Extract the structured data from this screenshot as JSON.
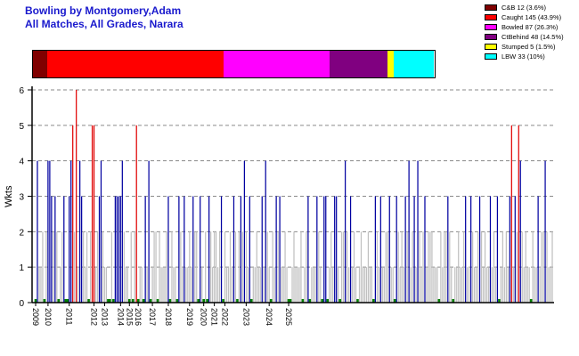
{
  "header": {
    "title_line1": "Bowling by Montgomery,Adam",
    "title_line2": "All Matches, All Grades, Narara"
  },
  "legend": [
    {
      "label": "C&B 12 (3.6%)",
      "color": "#800000"
    },
    {
      "label": "Caught 145 (43.9%)",
      "color": "#ff0000"
    },
    {
      "label": "Bowled 87 (26.3%)",
      "color": "#ff00ff"
    },
    {
      "label": "CtBehind 48 (14.5%)",
      "color": "#800080"
    },
    {
      "label": "Stumped 5 (1.5%)",
      "color": "#ffff00"
    },
    {
      "label": "LBW 33 (10%)",
      "color": "#00ffff"
    }
  ],
  "chart_data": {
    "type": "bar",
    "ylabel": "Wkts",
    "ylim": [
      0,
      6
    ],
    "yticks": [
      "0",
      "1",
      "2",
      "3",
      "4",
      "5",
      "6"
    ],
    "grid": "horizontal dashed",
    "dismissal_breakdown": [
      {
        "type": "C&B",
        "count": 12,
        "pct": 3.6
      },
      {
        "type": "Caught",
        "count": 145,
        "pct": 43.9
      },
      {
        "type": "Bowled",
        "count": 87,
        "pct": 26.3
      },
      {
        "type": "CtBehind",
        "count": 48,
        "pct": 14.5
      },
      {
        "type": "Stumped",
        "count": 5,
        "pct": 1.5
      },
      {
        "type": "LBW",
        "count": 33,
        "pct": 10
      }
    ],
    "x_year_labels": [
      "2009",
      "2010",
      "2011",
      "2012",
      "2013",
      "2014",
      "2015",
      "2016",
      "2017",
      "2018",
      "2019",
      "2020",
      "2021",
      "2022",
      "2023",
      "2024",
      "2025"
    ],
    "x_year_label_index": [
      0,
      7,
      19,
      33,
      39,
      48,
      53,
      58,
      66,
      75,
      87,
      95,
      101,
      107,
      119,
      132,
      143
    ],
    "bar_colors": {
      "low": "#c0c0c0",
      "three_four": "#0000a0",
      "five_plus": "#e00000",
      "zero": "#008000"
    },
    "wickets_per_innings": [
      0,
      4,
      1,
      1,
      2,
      0,
      2,
      4,
      4,
      3,
      2,
      3,
      2,
      0,
      1,
      2,
      3,
      0,
      0,
      3,
      4,
      5,
      2,
      6,
      1,
      4,
      3,
      2,
      1,
      2,
      0,
      2,
      5,
      5,
      1,
      2,
      3,
      4,
      2,
      1,
      1,
      0,
      0,
      2,
      0,
      3,
      3,
      3,
      3,
      4,
      2,
      1,
      1,
      0,
      2,
      0,
      2,
      5,
      0,
      1,
      1,
      0,
      3,
      1,
      4,
      0,
      1,
      2,
      2,
      0,
      2,
      1,
      1,
      1,
      2,
      3,
      0,
      2,
      1,
      1,
      0,
      3,
      2,
      1,
      3,
      1,
      1,
      2,
      1,
      3,
      2,
      2,
      0,
      3,
      1,
      0,
      2,
      0,
      3,
      2,
      1,
      2,
      2,
      1,
      2,
      3,
      0,
      2,
      1,
      1,
      2,
      1,
      3,
      2,
      0,
      2,
      3,
      2,
      4,
      2,
      1,
      3,
      0,
      1,
      1,
      2,
      1,
      1,
      3,
      1,
      4,
      2,
      1,
      0,
      2,
      1,
      3,
      2,
      3,
      1,
      1,
      2,
      1,
      0,
      0,
      1,
      2,
      1,
      1,
      1,
      2,
      0,
      1,
      2,
      3,
      0,
      1,
      1,
      1,
      3,
      2,
      1,
      0,
      3,
      3,
      0,
      1,
      2,
      1,
      3,
      3,
      1,
      0,
      2,
      2,
      4,
      2,
      1,
      3,
      1,
      2,
      1,
      0,
      1,
      2,
      1,
      1,
      1,
      2,
      1,
      1,
      0,
      3,
      2,
      1,
      3,
      1,
      1,
      2,
      2,
      3,
      1,
      1,
      0,
      3,
      2,
      1,
      2,
      1,
      3,
      2,
      4,
      1,
      2,
      3,
      1,
      4,
      2,
      1,
      2,
      3,
      1,
      2,
      2,
      2,
      1,
      1,
      1,
      0,
      2,
      1,
      2,
      2,
      3,
      2,
      1,
      0,
      1,
      1,
      2,
      1,
      1,
      2,
      3,
      1,
      1,
      3,
      2,
      1,
      1,
      2,
      3,
      2,
      1,
      2,
      1,
      1,
      3,
      1,
      2,
      1,
      3,
      0,
      1,
      2,
      1,
      2,
      1,
      3,
      5,
      1,
      3,
      2,
      5,
      4,
      2,
      1,
      2,
      1,
      1,
      0,
      2,
      1,
      1,
      3,
      1,
      2,
      2,
      4,
      2,
      1,
      1,
      2
    ]
  }
}
